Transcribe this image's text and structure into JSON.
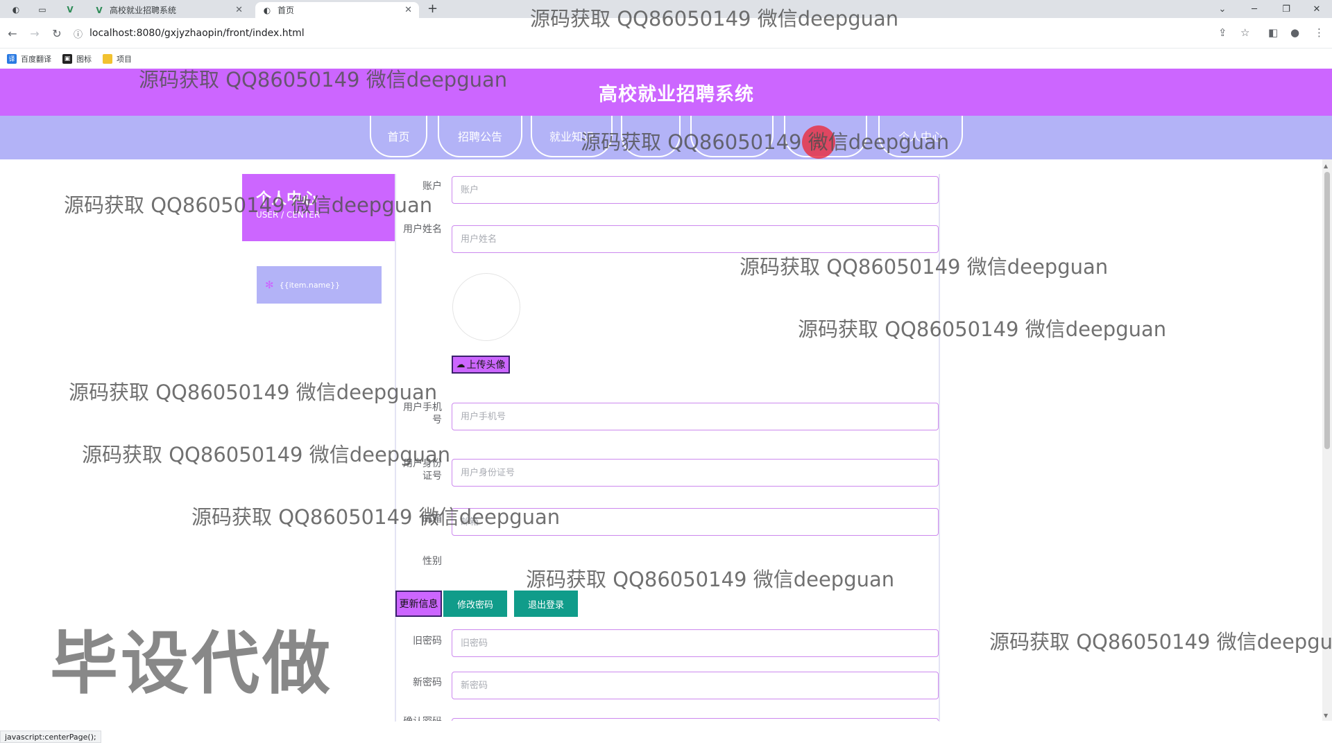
{
  "browser": {
    "tabs": [
      {
        "title": "高校就业招聘系统",
        "active": false
      },
      {
        "title": "首页",
        "active": true
      }
    ],
    "url": "localhost:8080/gxjyzhaopin/front/index.html",
    "bookmarks": [
      "百度翻译",
      "图标",
      "项目"
    ],
    "status_text": "javascript:centerPage();"
  },
  "site": {
    "title": "高校就业招聘系统",
    "nav": [
      "首页",
      "招聘公告",
      "就业知识",
      "",
      "",
      "",
      "个人中心"
    ]
  },
  "sidebar": {
    "card_title": "个人中心",
    "card_subtitle": "USER / CENTER",
    "menu_item": "{{item.name}}"
  },
  "form": {
    "account": {
      "label": "账户",
      "placeholder": "账户"
    },
    "name": {
      "label": "用户姓名",
      "placeholder": "用户姓名"
    },
    "upload_label": "上传头像",
    "phone": {
      "label": "用户手机号",
      "placeholder": "用户手机号"
    },
    "id_card": {
      "label": "用户身份证号",
      "placeholder": "用户身份证号"
    },
    "email": {
      "label": "邮箱",
      "placeholder": "邮箱"
    },
    "gender": {
      "label": "性别"
    },
    "buttons": {
      "update": "更新信息",
      "change_password": "修改密码",
      "logout": "退出登录"
    },
    "old_password": {
      "label": "旧密码",
      "placeholder": "旧密码"
    },
    "new_password": {
      "label": "新密码",
      "placeholder": "新密码"
    },
    "confirm_password": {
      "label": "确认密码"
    }
  },
  "watermarks": {
    "qq": "源码获取 QQ86050149 微信deepguan",
    "big": "毕设代做"
  },
  "colors": {
    "header": "#cc66ff",
    "nav": "#b3b3f7",
    "button_green": "#109c8a"
  }
}
